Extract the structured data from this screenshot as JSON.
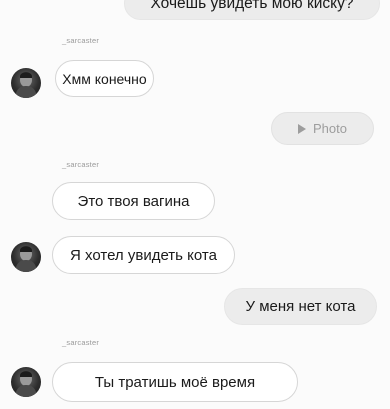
{
  "messages": [
    {
      "direction": "outgoing",
      "text": "Хочешь увидеть мою киску?"
    },
    {
      "direction": "incoming",
      "sender": "_sarcaster",
      "text": "Хмм конечно"
    },
    {
      "direction": "outgoing",
      "type": "photo",
      "text": "Photo"
    },
    {
      "direction": "incoming",
      "sender": "_sarcaster",
      "text": "Это твоя вагина"
    },
    {
      "direction": "incoming",
      "text": "Я хотел увидеть кота"
    },
    {
      "direction": "outgoing",
      "text": "У меня нет кота"
    },
    {
      "direction": "incoming",
      "sender": "_sarcaster",
      "text": "Ты тратишь моё время"
    }
  ],
  "icons": {
    "play": "play-icon",
    "avatar": "avatar"
  }
}
